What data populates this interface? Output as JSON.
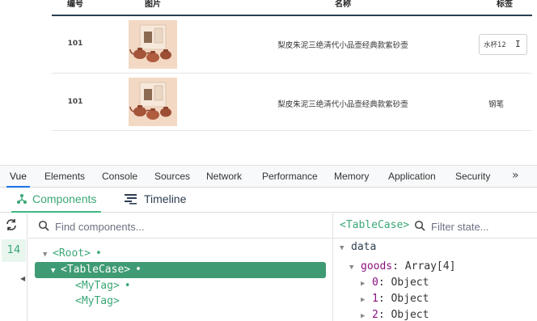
{
  "table": {
    "headers": [
      "编号",
      "图片",
      "名称",
      "标签"
    ],
    "rows": [
      {
        "id": "101",
        "name": "梨皮朱泥三绝清代小品壶经典款紫砂壶",
        "tag": "水杯12",
        "tag_editing": true
      },
      {
        "id": "101",
        "name": "梨皮朱泥三绝清代小品壶经典款紫砂壶",
        "tag": "钢笔",
        "tag_editing": false
      }
    ]
  },
  "devtools": {
    "tabs": [
      "Vue",
      "Elements",
      "Console",
      "Sources",
      "Network",
      "Performance",
      "Memory",
      "Application",
      "Security"
    ],
    "more": "»",
    "active_tab": "Vue"
  },
  "vue_panel": {
    "components_label": "Components",
    "timeline_label": "Timeline",
    "gutter_number": "14",
    "search_placeholder": "Find components...",
    "tree": [
      {
        "label": "<Root>",
        "dot": "•"
      },
      {
        "label": "<TableCase>",
        "dot": "•",
        "selected": true
      },
      {
        "label": "<MyTag>",
        "dot": "•"
      },
      {
        "label": "<MyTag>",
        "dot": ""
      }
    ],
    "selected_component": "<TableCase>",
    "state_filter_placeholder": "Filter state...",
    "state": {
      "section": "data",
      "goods_key": "goods",
      "goods_value": "Array[4]",
      "items": [
        {
          "key": "0",
          "value": "Object"
        },
        {
          "key": "1",
          "value": "Object"
        },
        {
          "key": "2",
          "value": "Object"
        }
      ]
    }
  },
  "colors": {
    "vue_green": "#42b883",
    "selected_row": "#3f9b73",
    "header_border": "#2c3e50"
  }
}
